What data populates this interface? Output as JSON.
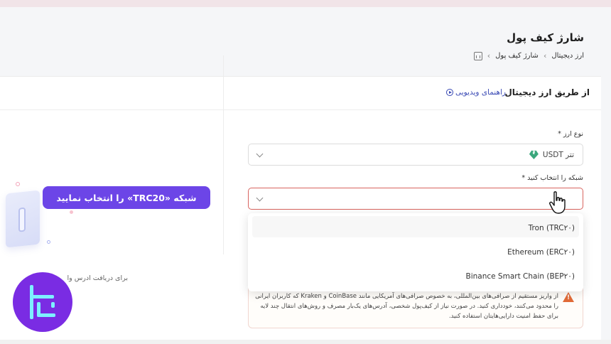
{
  "page": {
    "title": "شارژ کیف پول",
    "breadcrumb": [
      "شارژ کیف پول",
      "ارز دیجیتال"
    ]
  },
  "card": {
    "title": "از طریق ارز دیجیتال",
    "video_link": "راهنمای ویدیویی"
  },
  "form": {
    "currency_label": "نوع ارز *",
    "currency_value": "تتر USDT",
    "network_label": "شبکه را انتخاب کنید *",
    "network_value": ""
  },
  "dropdown": {
    "options": [
      "Tron (TRC۲۰)",
      "Ethereum (ERC۲۰)",
      "Binance Smart Chain (BEP۲۰)"
    ]
  },
  "warning": {
    "text": "از واریز مستقیم از صرافی‌های بین‌المللی، به خصوص صرافی‌های آمریکایی مانند CoinBase و Kraken که کاربران ایرانی را محدود می‌کنند، خودداری کنید. در صورت نیاز از کیف‌پول شخصی، آدرس‌های یک‌بار مصرف و روش‌های انتقال چند لایه برای حفظ امنیت دارایی‌هایتان استفاده کنید."
  },
  "tooltip": {
    "text": "شبکه «TRC20» را انتخاب نمایید"
  },
  "left_panel": {
    "text": "برای دریافت آدرس وا"
  },
  "colors": {
    "accent": "#6c45e7",
    "link": "#3b4bb5",
    "error_border": "#d8645f",
    "usdt": "#3aa77c",
    "logo_bg": "#7a2ce3",
    "logo_fg": "#7df0ff"
  }
}
